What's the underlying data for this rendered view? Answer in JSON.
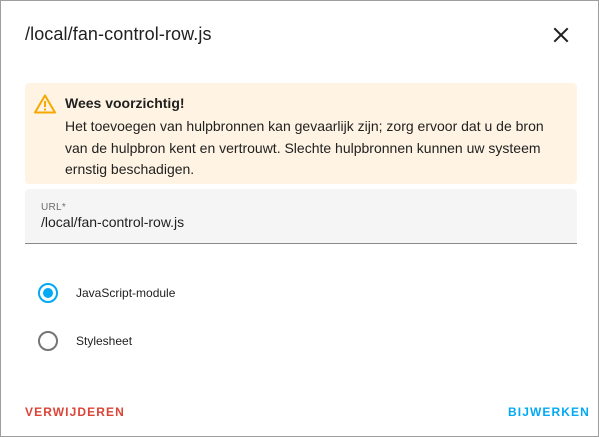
{
  "dialog": {
    "title": "/local/fan-control-row.js",
    "close_icon": "close-icon"
  },
  "warning": {
    "icon": "warning-triangle-icon",
    "icon_color": "#f7a800",
    "background": "#fff4e3",
    "title": "Wees voorzichtig!",
    "text": "Het toevoegen van hulpbronnen kan gevaarlijk zijn; zorg ervoor dat u de bron van de hulpbron kent en vertrouwt. Slechte hulpbronnen kunnen uw systeem ernstig beschadigen."
  },
  "url_field": {
    "label": "URL*",
    "value": "/local/fan-control-row.js"
  },
  "resource_type": {
    "options": [
      {
        "label": "JavaScript-module",
        "checked": true
      },
      {
        "label": "Stylesheet",
        "checked": false
      }
    ],
    "accent": "#03a9f4"
  },
  "actions": {
    "delete_label": "VERWIJDEREN",
    "delete_color": "#db4437",
    "update_label": "BIJWERKEN",
    "update_color": "#03a9f4"
  }
}
